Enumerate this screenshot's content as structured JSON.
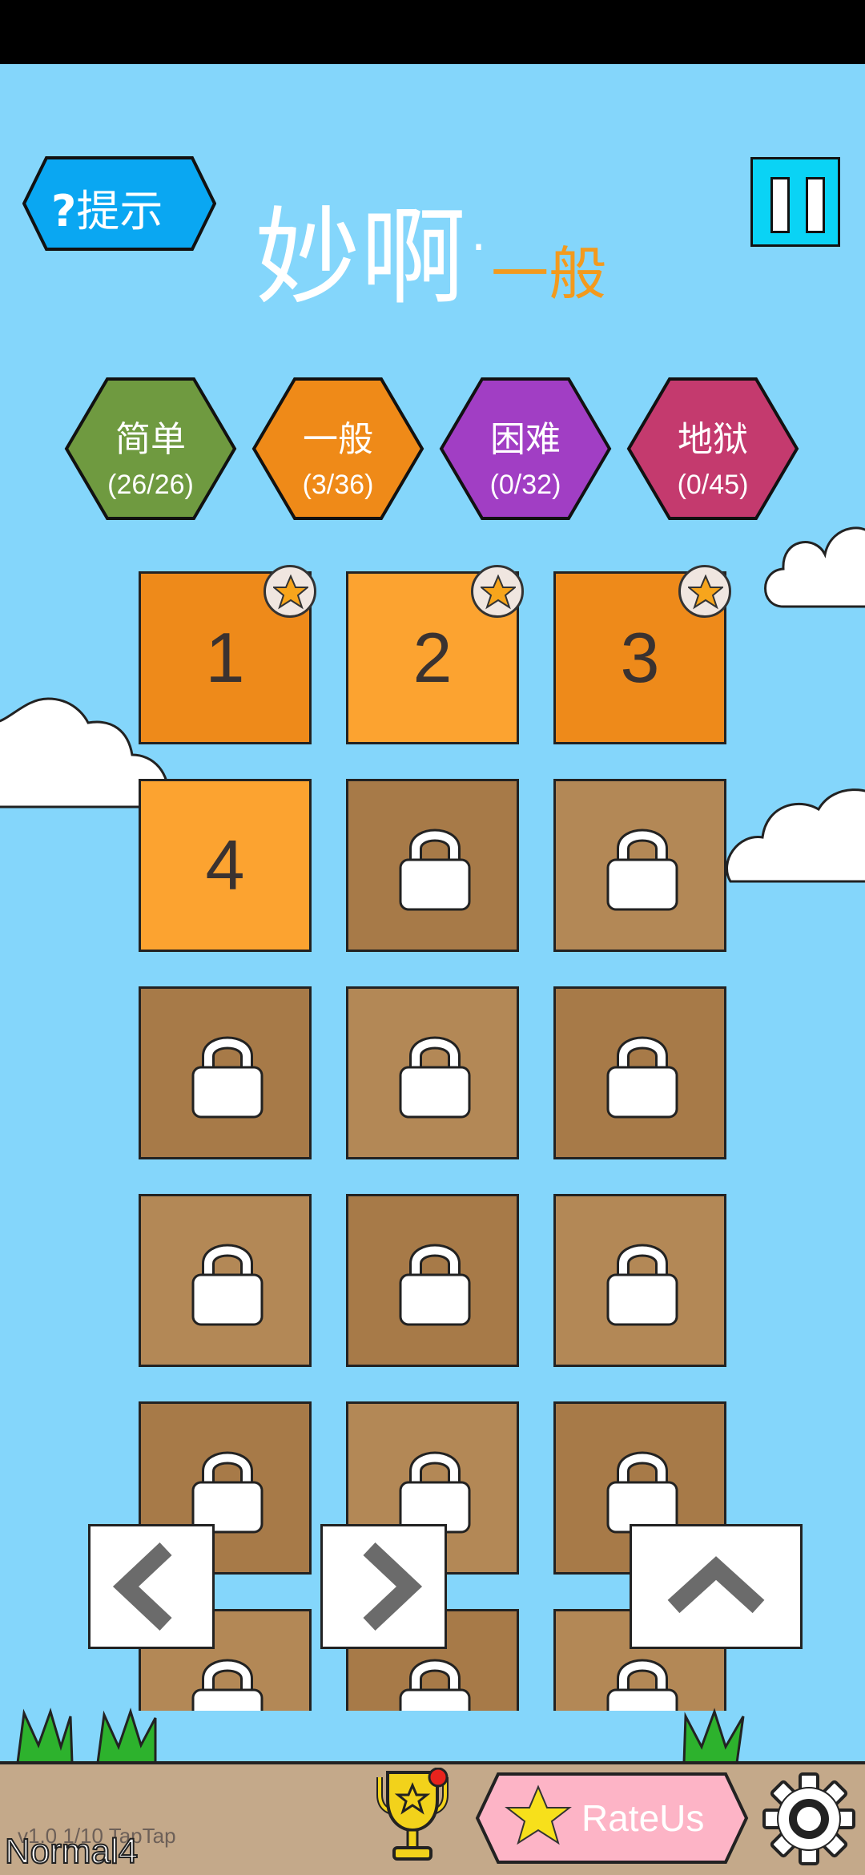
{
  "header": {
    "hint_label": "提示",
    "hint_icon": "question-mark-icon",
    "title_main": "妙啊",
    "title_sep": "·",
    "title_sub": "一般",
    "pause_icon": "pause-icon"
  },
  "difficulties": [
    {
      "name": "简单",
      "count": "(26/26)",
      "color": "#6f9a40"
    },
    {
      "name": "一般",
      "count": "(3/36)",
      "color": "#ef8a18"
    },
    {
      "name": "困难",
      "count": "(0/32)",
      "color": "#a13ec4"
    },
    {
      "name": "地狱",
      "count": "(0/45)",
      "color": "#c43a6e"
    }
  ],
  "levels": [
    {
      "num": "1",
      "state": "completed",
      "starred": true
    },
    {
      "num": "2",
      "state": "completed",
      "starred": true
    },
    {
      "num": "3",
      "state": "completed",
      "starred": true
    },
    {
      "num": "4",
      "state": "unlocked",
      "starred": false
    },
    {
      "state": "locked"
    },
    {
      "state": "locked"
    },
    {
      "state": "locked"
    },
    {
      "state": "locked"
    },
    {
      "state": "locked"
    },
    {
      "state": "locked"
    },
    {
      "state": "locked"
    },
    {
      "state": "locked"
    },
    {
      "state": "locked"
    },
    {
      "state": "locked"
    },
    {
      "state": "locked"
    },
    {
      "state": "locked"
    },
    {
      "state": "locked"
    },
    {
      "state": "locked"
    }
  ],
  "nav": {
    "prev_icon": "chevron-left-icon",
    "next_icon": "chevron-right-icon",
    "up_icon": "chevron-up-icon"
  },
  "footer": {
    "rate_label": "RateUs",
    "version": "v1.0 1/10 TapTap",
    "level_name": "Normal4",
    "trophy_icon": "trophy-icon",
    "settings_icon": "gear-icon"
  }
}
